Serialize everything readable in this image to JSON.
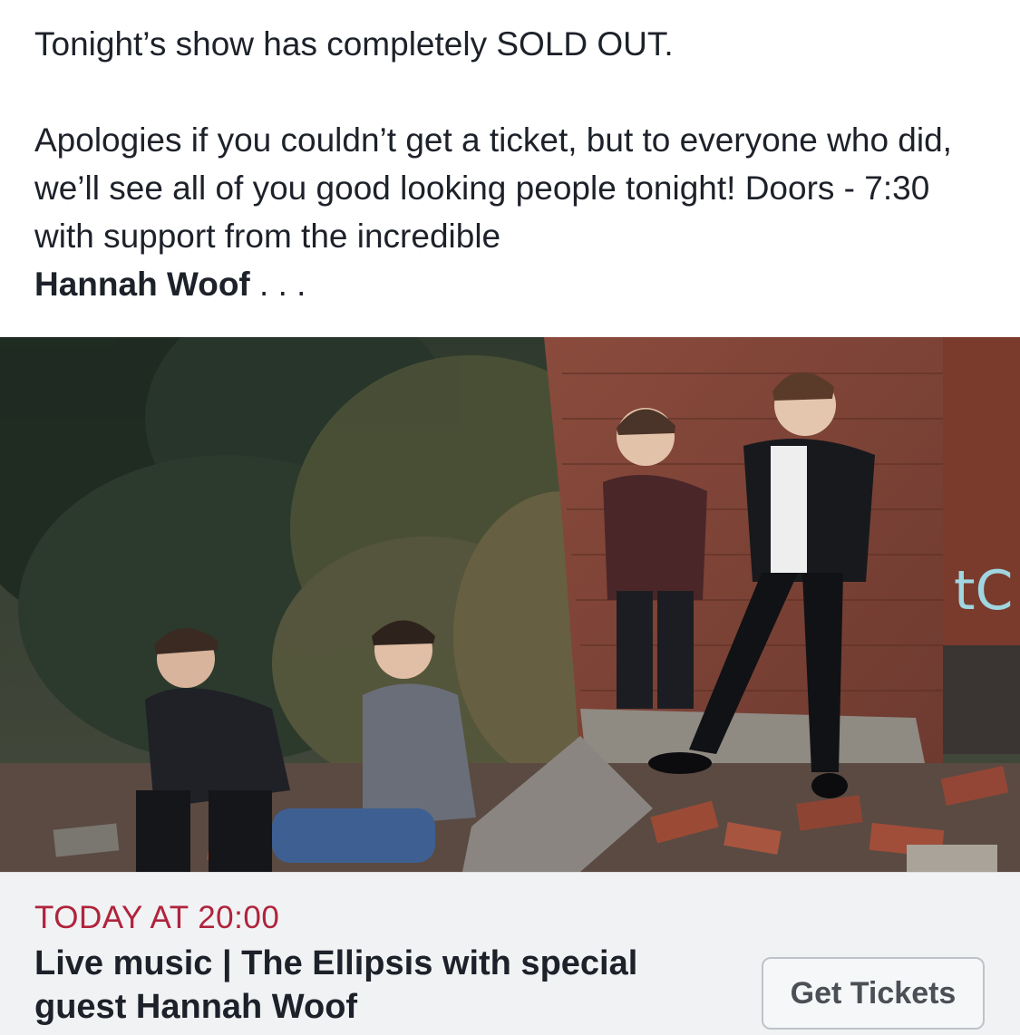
{
  "post": {
    "line1": "Tonight’s show has completely SOLD OUT.",
    "body_before": "Apologies if you couldn’t get a ticket, but to everyone who did, we’ll see all of you good looking people tonight! Doors - 7:30 with support from the incredible",
    "mention": "Hannah Woof",
    "ellipsis": " . . ."
  },
  "photo": {
    "graffiti_text": "tC"
  },
  "event": {
    "date_label": "TODAY AT 20:00",
    "title": "Live music | The Ellipsis with special guest Hannah Woof",
    "button_label": "Get Tickets"
  },
  "colors": {
    "text": "#1d2129",
    "date_accent": "#b0243c",
    "event_bg": "#f1f2f4",
    "button_border": "#bec3c9"
  }
}
